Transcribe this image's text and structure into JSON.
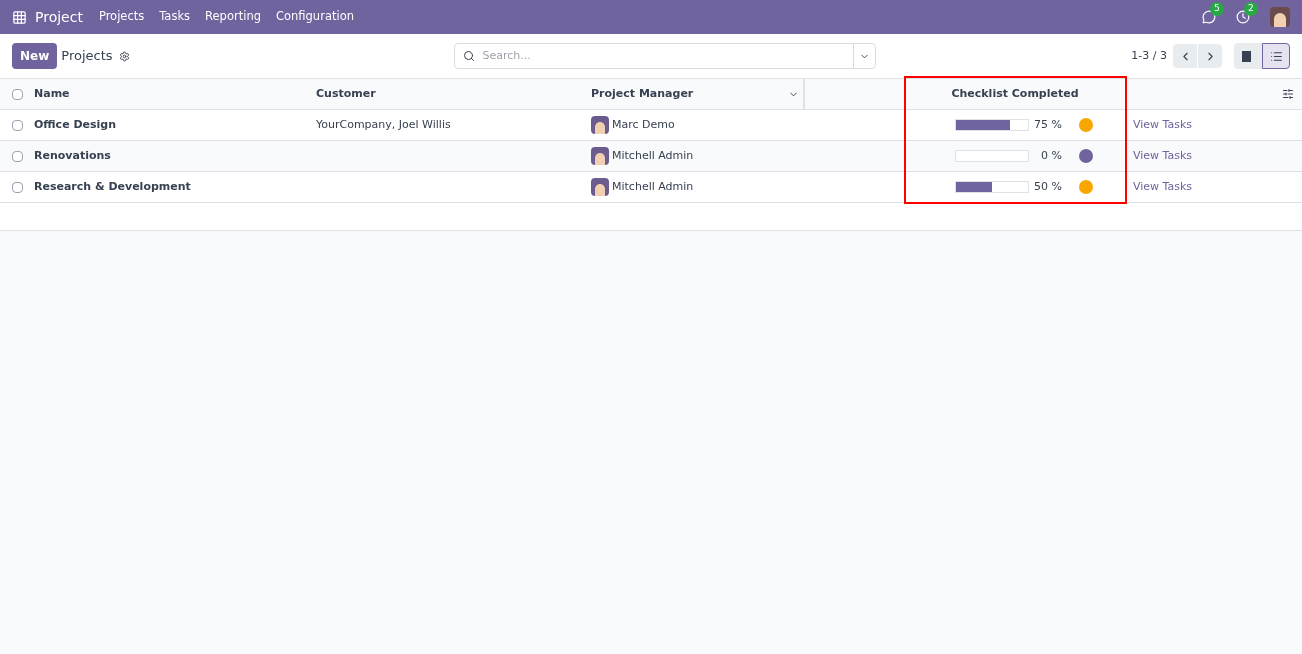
{
  "navbar": {
    "app": "Project",
    "menu": [
      "Projects",
      "Tasks",
      "Reporting",
      "Configuration"
    ],
    "messages_count": "5",
    "activities_count": "2"
  },
  "control_panel": {
    "new_button": "New",
    "breadcrumb": "Projects",
    "search": {
      "placeholder": "Search..."
    },
    "pager": "1-3 / 3",
    "views": [
      {
        "kind": "kanban",
        "selected": false
      },
      {
        "kind": "list",
        "selected": true
      }
    ]
  },
  "table": {
    "select_all_checked": false,
    "columns": [
      "Name",
      "Customer",
      "Project Manager",
      "Checklist Completed"
    ],
    "rows": [
      {
        "checked": false,
        "name": "Office Design",
        "customer": "YourCompany, Joel Willis",
        "manager": "Marc Demo",
        "level": 0.75,
        "percent": "75 %",
        "color": "#f9a602",
        "action": "View Tasks"
      },
      {
        "checked": false,
        "name": "Renovations",
        "manager": "Mitchell Admin",
        "level": 0,
        "percent": "0 %",
        "color": "#71639e",
        "action": "View Tasks"
      },
      {
        "checked": false,
        "name": "Research & Development",
        "manager": "Mitchell Admin",
        "level": 0.5,
        "percent": "50 %",
        "color": "#f9a602",
        "action": "View Tasks"
      }
    ]
  }
}
